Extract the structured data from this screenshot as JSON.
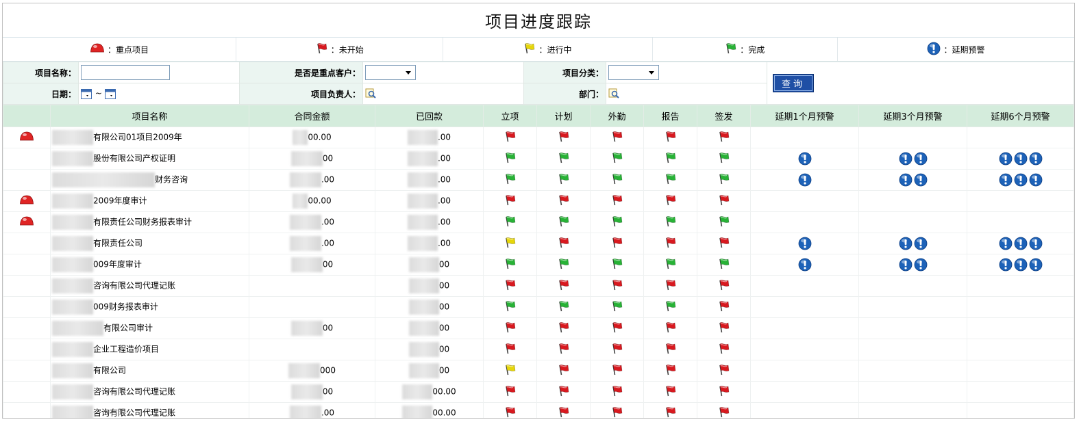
{
  "page": {
    "title": "项目进度跟踪"
  },
  "legend": [
    {
      "icon": "key-project-icon",
      "label": "：重点项目"
    },
    {
      "icon": "red-flag-icon",
      "label": "：未开始"
    },
    {
      "icon": "yellow-flag-icon",
      "label": "：进行中"
    },
    {
      "icon": "green-flag-icon",
      "label": "：完成"
    },
    {
      "icon": "delay-warning-icon",
      "label": "：延期预警"
    }
  ],
  "filters": {
    "project_name_label": "项目名称：",
    "project_name_value": "",
    "key_customer_label": "是否是重点客户：",
    "key_customer_selected": "",
    "category_label": "项目分类：",
    "category_selected": "",
    "date_label": "日期：",
    "date_sep": "~",
    "owner_label": "项目负责人：",
    "dept_label": "部门：",
    "query_label": "查询"
  },
  "colors": {
    "red": "#d8191f",
    "yellow": "#e6d60a",
    "green": "#28b236",
    "warn": "#1d62b8",
    "key": "#e02424"
  },
  "table": {
    "headers": [
      "项目名称",
      "合同金额",
      "已回款",
      "立项",
      "计划",
      "外勤",
      "报告",
      "签发",
      "延期1个月预警",
      "延期3个月预警",
      "延期6个月预警"
    ],
    "rows": [
      {
        "key": true,
        "name": "有限公司01项目2009年",
        "contract": "00.00",
        "received": ".00",
        "flags": [
          "red",
          "red",
          "red",
          "red",
          "red"
        ],
        "w1": 0,
        "w3": 0,
        "w6": 0
      },
      {
        "key": false,
        "name": "股份有限公司产权证明",
        "contract": "00",
        "received": ".00",
        "flags": [
          "green",
          "green",
          "green",
          "green",
          "green"
        ],
        "w1": 1,
        "w3": 2,
        "w6": 3
      },
      {
        "key": false,
        "name": "财务咨询",
        "contract": ".00",
        "received": ".00",
        "flags": [
          "green",
          "green",
          "green",
          "green",
          "green"
        ],
        "w1": 1,
        "w3": 2,
        "w6": 3
      },
      {
        "key": true,
        "name": "2009年度审计",
        "contract": "00.00",
        "received": ".00",
        "flags": [
          "red",
          "red",
          "red",
          "red",
          "red"
        ],
        "w1": 0,
        "w3": 0,
        "w6": 0
      },
      {
        "key": true,
        "name": "有限责任公司财务报表审计",
        "contract": ".00",
        "received": ".00",
        "flags": [
          "green",
          "green",
          "green",
          "green",
          "green"
        ],
        "w1": 0,
        "w3": 0,
        "w6": 0
      },
      {
        "key": false,
        "name": "有限责任公司",
        "contract": ".00",
        "received": ".00",
        "flags": [
          "yellow",
          "red",
          "red",
          "red",
          "red"
        ],
        "w1": 1,
        "w3": 2,
        "w6": 3
      },
      {
        "key": false,
        "name": "009年度审计",
        "contract": "00",
        "received": "00",
        "flags": [
          "green",
          "green",
          "green",
          "green",
          "green"
        ],
        "w1": 1,
        "w3": 2,
        "w6": 3
      },
      {
        "key": false,
        "name": "咨询有限公司代理记账",
        "contract": "",
        "received": "00",
        "flags": [
          "red",
          "red",
          "red",
          "red",
          "red"
        ],
        "w1": 0,
        "w3": 0,
        "w6": 0
      },
      {
        "key": false,
        "name": "009财务报表审计",
        "contract": "",
        "received": "00",
        "flags": [
          "green",
          "green",
          "green",
          "green",
          "red"
        ],
        "w1": 0,
        "w3": 0,
        "w6": 0
      },
      {
        "key": false,
        "name": "有限公司审计",
        "contract": "00",
        "received": "00",
        "flags": [
          "red",
          "red",
          "red",
          "red",
          "red"
        ],
        "w1": 0,
        "w3": 0,
        "w6": 0
      },
      {
        "key": false,
        "name": "企业工程造价项目",
        "contract": "",
        "received": "00",
        "flags": [
          "red",
          "red",
          "red",
          "red",
          "red"
        ],
        "w1": 0,
        "w3": 0,
        "w6": 0
      },
      {
        "key": false,
        "name": "有限公司",
        "contract": "000",
        "received": "00",
        "flags": [
          "yellow",
          "red",
          "red",
          "red",
          "red"
        ],
        "w1": 0,
        "w3": 0,
        "w6": 0
      },
      {
        "key": false,
        "name": "咨询有限公司代理记账",
        "contract": "00",
        "received": "00.00",
        "flags": [
          "red",
          "red",
          "red",
          "red",
          "red"
        ],
        "w1": 0,
        "w3": 0,
        "w6": 0
      },
      {
        "key": false,
        "name": "咨询有限公司代理记账",
        "contract": ".00",
        "received": "00.00",
        "flags": [
          "red",
          "red",
          "red",
          "red",
          "red"
        ],
        "w1": 0,
        "w3": 0,
        "w6": 0
      }
    ]
  }
}
